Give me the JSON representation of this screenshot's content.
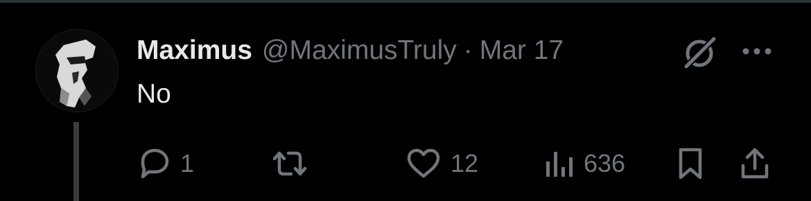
{
  "post": {
    "display_name": "Maximus",
    "handle": "@MaximusTruly",
    "separator": "·",
    "date": "Mar 17",
    "text": "No"
  },
  "actions": {
    "reply": {
      "icon": "reply-icon",
      "count": "1"
    },
    "retweet": {
      "icon": "retweet-icon",
      "count": ""
    },
    "like": {
      "icon": "heart-icon",
      "count": "12"
    },
    "views": {
      "icon": "views-icon",
      "count": "636"
    },
    "bookmark": {
      "icon": "bookmark-icon"
    },
    "share": {
      "icon": "share-icon"
    }
  },
  "colors": {
    "background": "#000000",
    "primary_text": "#e7e9ea",
    "secondary_text": "#71767b",
    "divider": "#2f3336",
    "thread_line": "#3a3d40"
  }
}
